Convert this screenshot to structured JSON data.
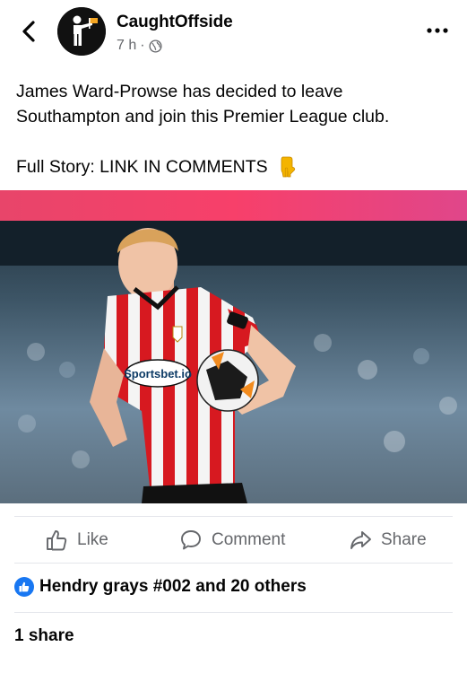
{
  "post": {
    "page_name": "CaughtOffside",
    "time": "7 h",
    "separator": "·",
    "text_line1": "James Ward-Prowse has decided to leave",
    "text_line2": "Southampton and join this Premier League club.",
    "story_text": "Full Story: LINK IN COMMENTS",
    "story_emoji": "pointing-down-emoji"
  },
  "photo": {
    "sponsor_text": "Sportsbet.io"
  },
  "actions": {
    "like": "Like",
    "comment": "Comment",
    "share": "Share"
  },
  "engagement": {
    "reactions": "Hendry grays #002 and 20 others",
    "shares": "1 share"
  },
  "icons": {
    "back": "chevron-left-icon",
    "privacy": "globe-icon",
    "more": "more-horizontal-icon",
    "like": "thumbs-up-icon",
    "comment": "comment-icon",
    "share": "share-arrow-icon",
    "reaction_badge": "like-reaction-icon"
  },
  "colors": {
    "accent": "#1877f2",
    "secondary_text": "#65676b",
    "kit_red": "#d71920"
  }
}
